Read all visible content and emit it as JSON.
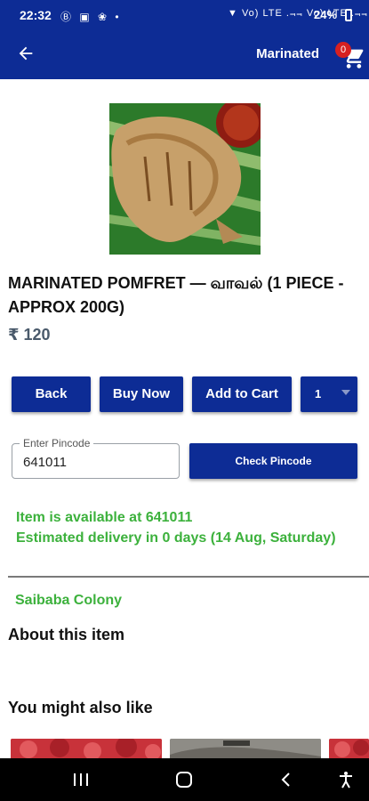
{
  "status_bar": {
    "time": "22:32",
    "left_icons": "Ⓑ ▣ ❀ •",
    "right_icons": "▼ Vo) LTE .⫬⫬ Vo) LTE .⫬⫬",
    "battery": "24%"
  },
  "app_bar": {
    "title": "Marinated",
    "cart_count": "0",
    "back_icon": "back-arrow-icon",
    "cart_icon": "shopping-cart-icon"
  },
  "product": {
    "title": "MARINATED POMFRET — வாவல் (1 PIECE - APPROX 200G)",
    "price": "₹ 120"
  },
  "actions": {
    "back_label": "Back",
    "buy_now_label": "Buy Now",
    "add_to_cart_label": "Add to Cart",
    "quantity": "1"
  },
  "pincode": {
    "label": "Enter Pincode",
    "value": "641011",
    "check_label": "Check Pincode"
  },
  "availability": {
    "line1": "Item is available at 641011",
    "line2": "Estimated delivery in 0 days (14 Aug, Saturday)"
  },
  "area": "Saibaba Colony",
  "sections": {
    "about": "About this item",
    "also_like": "You might also like"
  },
  "colors": {
    "primary": "#0d2c95",
    "success": "#3cb13c",
    "badge": "#d62020",
    "price": "#4a5a6b"
  }
}
